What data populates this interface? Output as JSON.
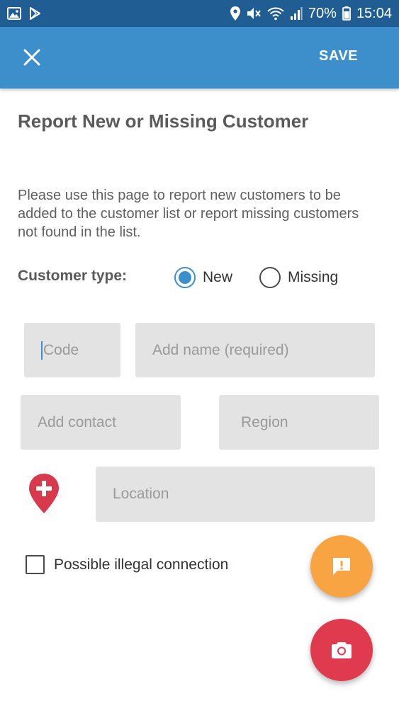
{
  "status_bar": {
    "battery": "70%",
    "time": "15:04"
  },
  "app_bar": {
    "save_label": "SAVE"
  },
  "form": {
    "title": "Report New or Missing Customer",
    "intro": "Please use this page to report new customers to be added to the customer list or report missing customers not found in the list.",
    "customer_type_label": "Customer type:",
    "customer_type_options": [
      "New",
      "Missing"
    ],
    "customer_type_selected": "New",
    "fields": {
      "code_placeholder": "Code",
      "name_placeholder": "Add name (required)",
      "contact_placeholder": "Add contact",
      "region_placeholder": "Region",
      "location_placeholder": "Location"
    },
    "illegal_connection_label": "Possible illegal connection",
    "illegal_connection_checked": false
  },
  "icons": {
    "close": "close-icon",
    "add_location": "add-location-pin-icon",
    "feedback": "feedback-icon",
    "camera": "camera-icon"
  },
  "colors": {
    "status_bar": "#1f5d93",
    "app_bar": "#3d8fcb",
    "field_bg": "#e3e3e3",
    "pin": "#d83a4d",
    "fab_feedback": "#f9a443",
    "fab_camera": "#e03a4e"
  }
}
